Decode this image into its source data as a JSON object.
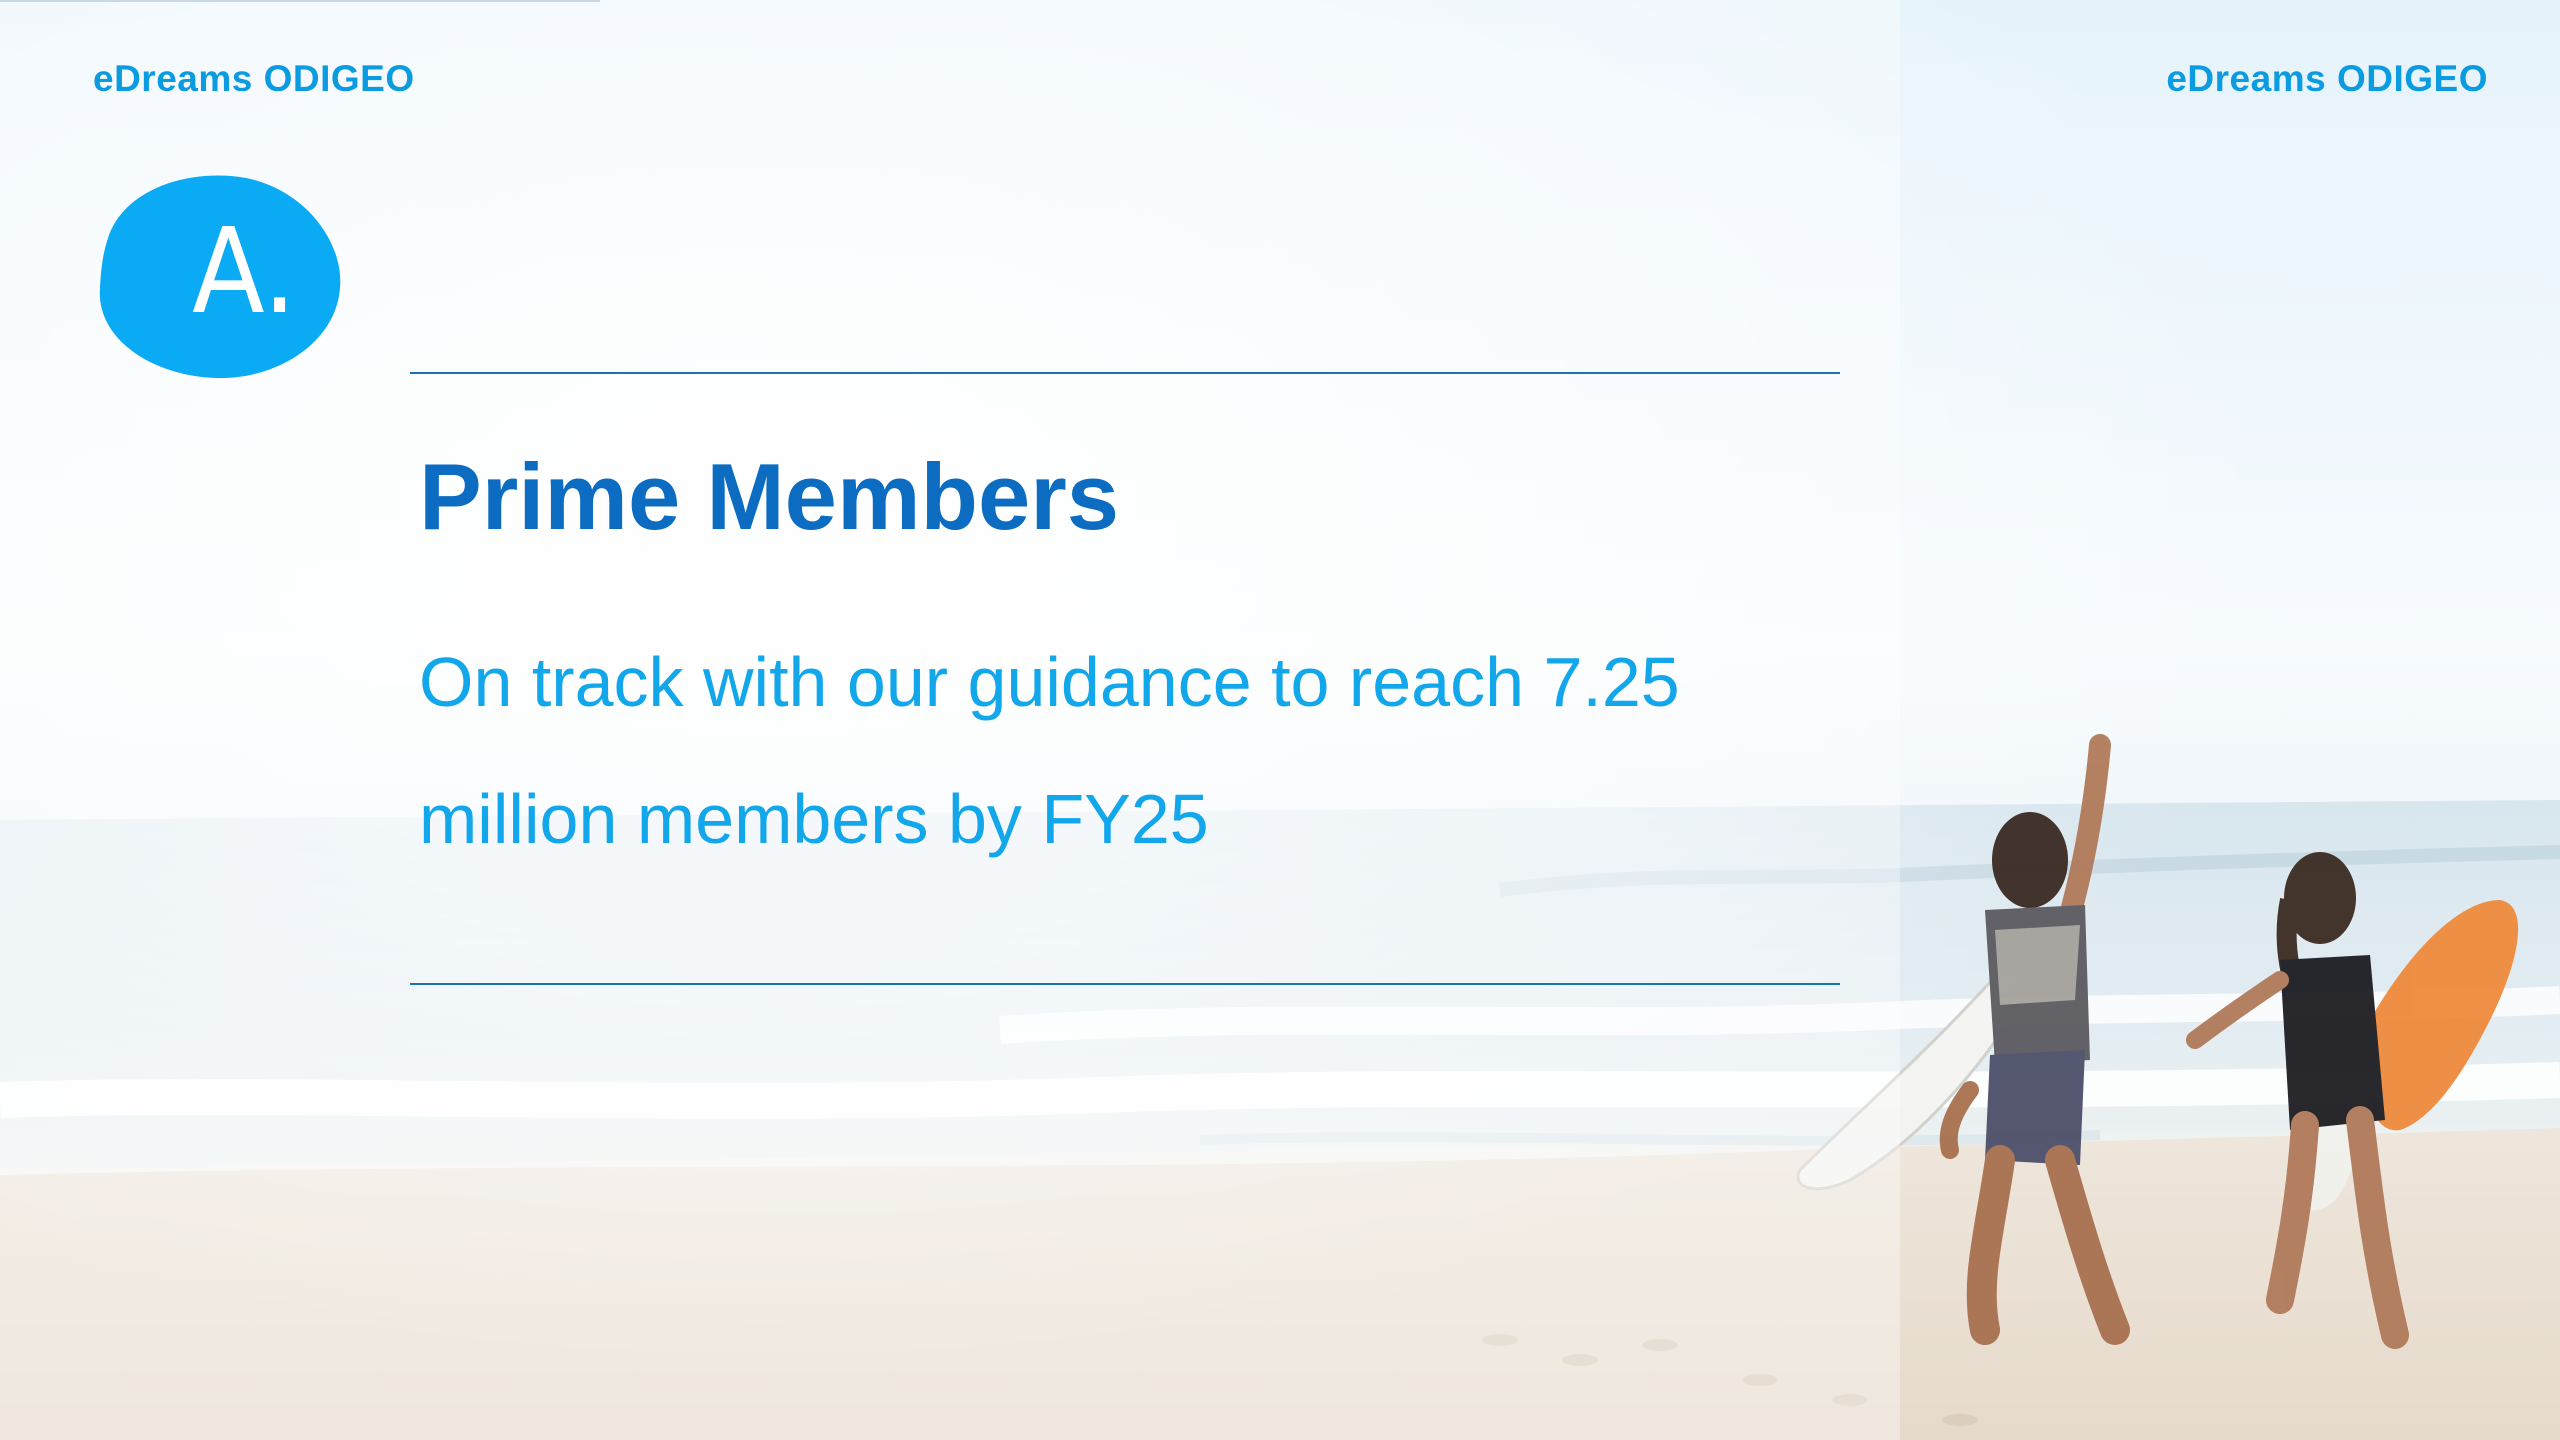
{
  "header": {
    "brand_left": "eDreams ODIGEO",
    "brand_right": "eDreams ODIGEO"
  },
  "section_badge": {
    "letter": "A.",
    "color": "#0aaaf4"
  },
  "content": {
    "title": "Prime Members",
    "subtitle_line_1": "On track with our guidance to reach 7.25",
    "subtitle_line_2": "million members by FY25"
  },
  "colors": {
    "brand_blue": "#0a9be0",
    "title_blue": "#0b6cc1",
    "subtitle_blue": "#12a6ea",
    "rule_blue": "#1a73b2"
  },
  "background_image": {
    "description_icon": "beach-surfers-photo"
  }
}
